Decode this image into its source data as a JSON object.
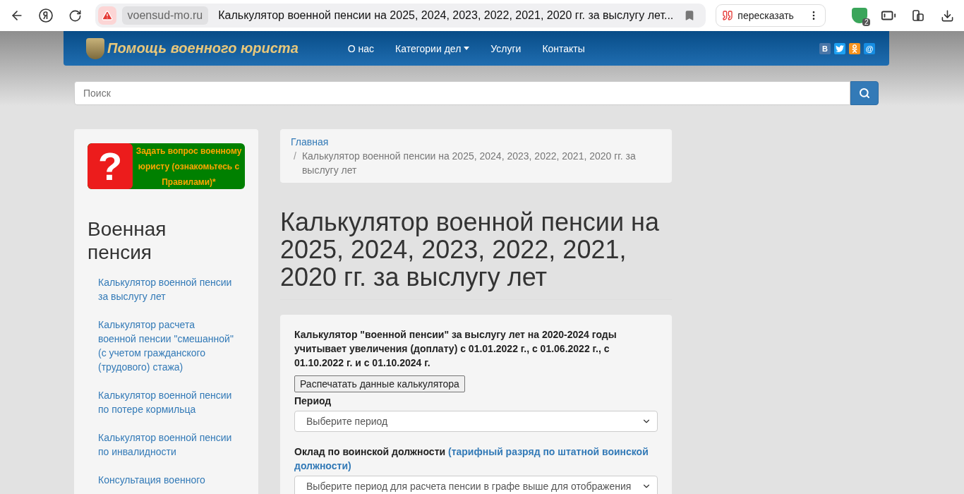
{
  "browser": {
    "domain": "voensud-mo.ru",
    "tab_title": "Калькулятор военной пенсии на 2025, 2024, 2023, 2022, 2021, 2020 гг. за выслугу лет...",
    "retell": "пересказать",
    "extension_badge": "2"
  },
  "navbar": {
    "brand": "Помощь военного юриста",
    "items": [
      {
        "label": "О нас",
        "dropdown": false
      },
      {
        "label": "Категории дел",
        "dropdown": true
      },
      {
        "label": "Услуги",
        "dropdown": false
      },
      {
        "label": "Контакты",
        "dropdown": false
      }
    ],
    "social": [
      {
        "kind": "vk",
        "label": "B"
      },
      {
        "kind": "twitter"
      },
      {
        "kind": "ok"
      },
      {
        "kind": "mail",
        "label": "@"
      }
    ]
  },
  "search": {
    "placeholder": "Поиск"
  },
  "sidebar": {
    "ask_icon": "?",
    "ask_banner": "Задать вопрос военному юристу (ознакомьтесь с Правилами)*",
    "heading": "Военная пенсия",
    "links": [
      "Калькулятор военной пенсии за выслугу лет",
      "Калькулятор расчета военной пенсии \"смешанной\" (с учетом гражданского (трудового) стажа)",
      "Калькулятор военной пенсии по потере кормильца",
      "Калькулятор военной пенсии по инвалидности",
      "Консультация военного"
    ]
  },
  "breadcrumb": {
    "separator": "/",
    "items": [
      "Главная",
      "Калькулятор военной пенсии на 2025, 2024, 2023, 2022, 2021, 2020 гг. за выслугу лет"
    ]
  },
  "title": "Калькулятор военной пенсии на 2025, 2024, 2023, 2022, 2021, 2020 гг. за выслугу лет",
  "calculator": {
    "intro": "Калькулятор \"военной пенсии\" за выслугу лет на 2020-2024 годы учитывает увеличения (доплату) с 01.01.2022 г., с 01.06.2022 г., с 01.10.2022 г. и с 01.10.2024 г.",
    "print_button": "Распечатать данные калькулятора",
    "fields": [
      {
        "label": "Период",
        "select": "Выберите период"
      },
      {
        "label": "Оклад по воинской должности",
        "hint": "(тарифный разряд по штатной воинской должности)",
        "select": "Выберите период для расчета пенсии в графе выше для отображения"
      }
    ]
  }
}
